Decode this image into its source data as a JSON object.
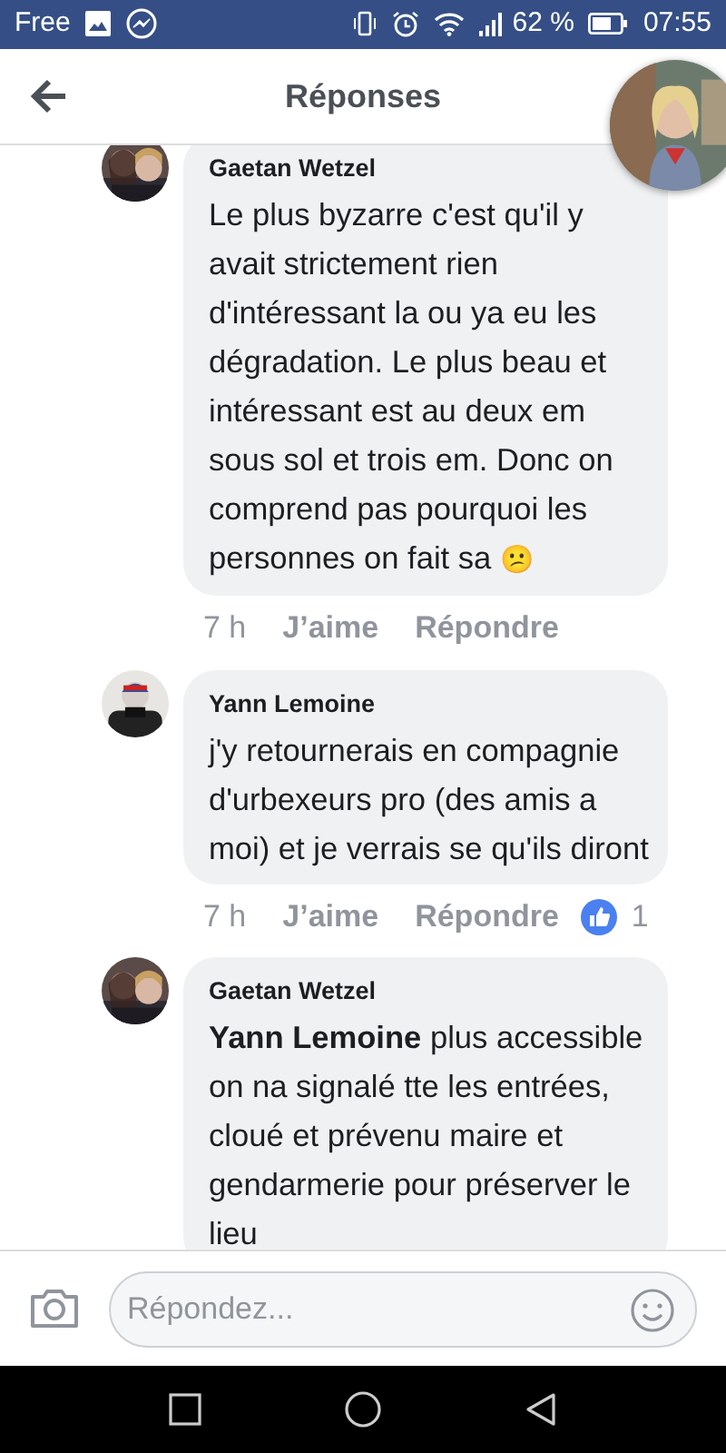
{
  "status_bar": {
    "carrier": "Free",
    "battery": "62 %",
    "time": "07:55"
  },
  "header": {
    "title": "Réponses"
  },
  "comments": [
    {
      "author": "Gaetan Wetzel",
      "text": "Le plus byzarre c'est qu'il y avait strictement rien d'intéressant la ou ya eu les dégradation. Le plus beau et intéressant est au deux em sous sol et trois em. Donc on comprend pas pourquoi les personnes on fait sa",
      "emoji": "😕",
      "time": "7 h",
      "like": "J’aime",
      "reply": "Répondre"
    },
    {
      "author": "Yann Lemoine",
      "text": "j'y retournerais en compagnie d'urbexeurs pro (des amis a moi) et je verrais se qu'ils diront",
      "time": "7 h",
      "like": "J’aime",
      "reply": "Répondre",
      "reactions": "1"
    },
    {
      "author": "Gaetan Wetzel",
      "text": "**Yann Lemoine** plus accessible on na signalé tte les entrées, cloué et prévenu maire et gendarmerie pour préserver le lieu"
    }
  ],
  "composer": {
    "placeholder": "Répondez..."
  }
}
